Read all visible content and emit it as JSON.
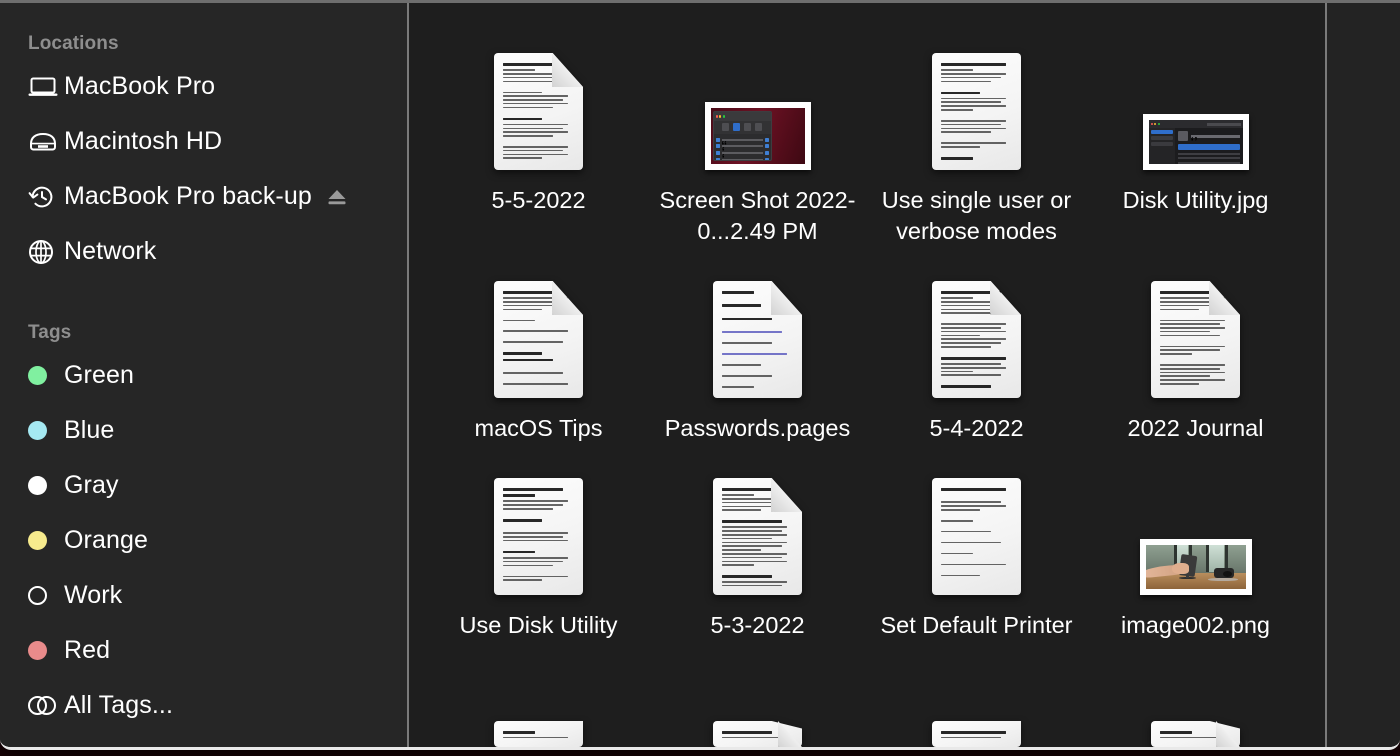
{
  "window": {
    "title": "Finder",
    "accent_color": "#2f6ecb",
    "sidebar_bg": "#262626",
    "content_bg": "#1e1e1e",
    "desktop_color": "#2b060e"
  },
  "sidebar": {
    "sections": [
      {
        "title": "Locations",
        "items": [
          {
            "label": "MacBook Pro",
            "icon": "laptop-icon",
            "eject": false
          },
          {
            "label": "Macintosh HD",
            "icon": "internal-drive-icon",
            "eject": false
          },
          {
            "label": "MacBook Pro back-up",
            "icon": "time-machine-icon",
            "eject": true
          },
          {
            "label": "Network",
            "icon": "globe-icon",
            "eject": false
          }
        ]
      },
      {
        "title": "Tags",
        "items": [
          {
            "label": "Green",
            "icon": "tag-dot-icon",
            "color": "#80f0a0"
          },
          {
            "label": "Blue",
            "icon": "tag-dot-icon",
            "color": "#a5e9f2"
          },
          {
            "label": "Gray",
            "icon": "tag-dot-icon",
            "color": "#ffffff"
          },
          {
            "label": "Orange",
            "icon": "tag-dot-icon",
            "color": "#f7eb8d"
          },
          {
            "label": "Work",
            "icon": "tag-ring-icon",
            "color": "none"
          },
          {
            "label": "Red",
            "icon": "tag-dot-icon",
            "color": "#e98b8b"
          },
          {
            "label": "All Tags...",
            "icon": "all-tags-icon",
            "color": "none"
          }
        ]
      }
    ]
  },
  "files": [
    {
      "name": "5-5-2022",
      "kind": "document"
    },
    {
      "name": "Screen Shot 2022-0...2.49 PM",
      "kind": "screenshot-prefs"
    },
    {
      "name": "Use single user or verbose modes",
      "kind": "document"
    },
    {
      "name": "Disk Utility.jpg",
      "kind": "screenshot-disk"
    },
    {
      "name": "macOS Tips",
      "kind": "document"
    },
    {
      "name": "Passwords.pages",
      "kind": "document-links"
    },
    {
      "name": "5-4-2022",
      "kind": "document"
    },
    {
      "name": "2022 Journal",
      "kind": "document"
    },
    {
      "name": "Use Disk Utility",
      "kind": "document"
    },
    {
      "name": "5-3-2022",
      "kind": "document"
    },
    {
      "name": "Set Default Printer",
      "kind": "document"
    },
    {
      "name": "image002.png",
      "kind": "photo-desk"
    }
  ],
  "partial_row": [
    {
      "name": "",
      "kind": "document"
    },
    {
      "name": "",
      "kind": "document"
    },
    {
      "name": "",
      "kind": "document"
    },
    {
      "name": "",
      "kind": "document"
    }
  ]
}
